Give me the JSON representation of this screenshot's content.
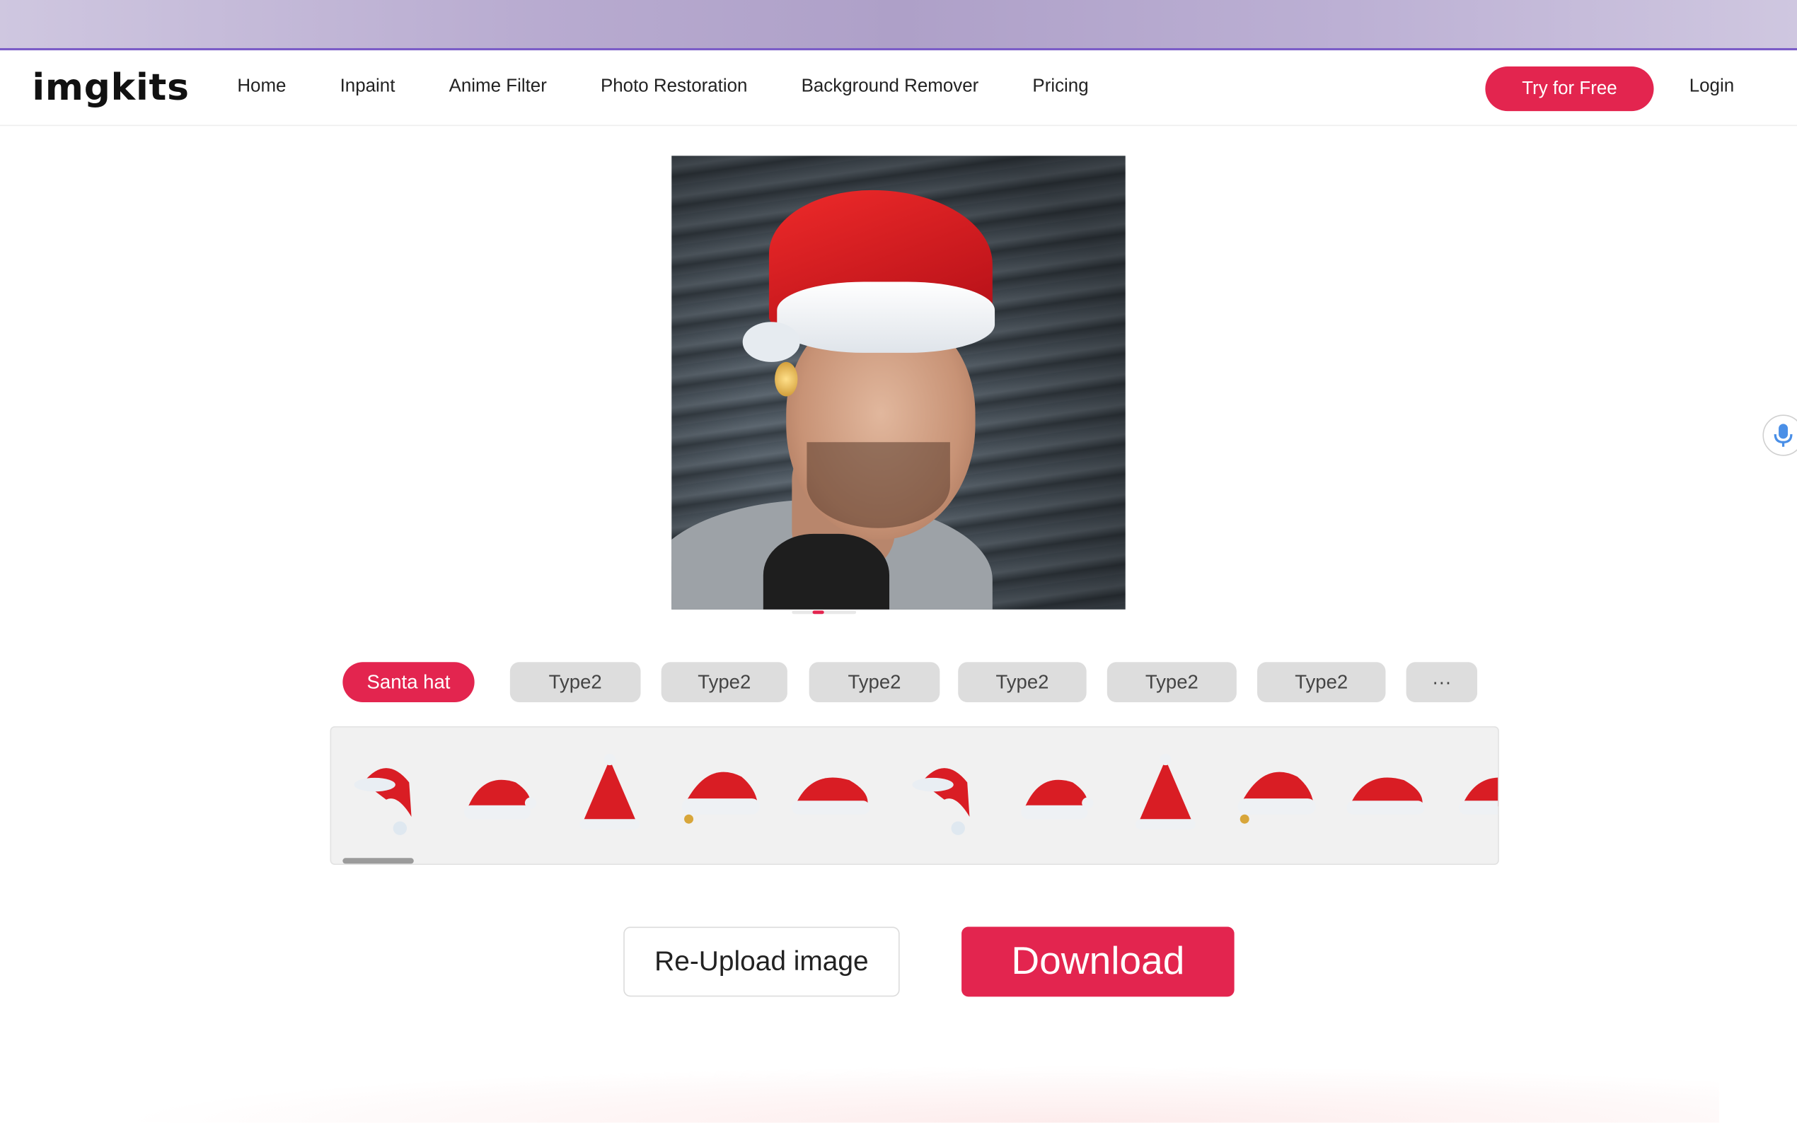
{
  "brand": {
    "logo": "imgkits"
  },
  "nav": {
    "items": [
      "Home",
      "Inpaint",
      "Anime Filter",
      "Photo Restoration",
      "Background Remover",
      "Pricing"
    ],
    "cta": "Try for Free",
    "login": "Login"
  },
  "tabs": [
    "Santa hat",
    "Type2",
    "Type2",
    "Type2",
    "Type2",
    "Type2",
    "Type2",
    "···"
  ],
  "hats": [
    "santa-hat-icon",
    "santa-hat-icon",
    "santa-hat-icon",
    "santa-hat-icon",
    "santa-hat-icon",
    "santa-hat-icon",
    "santa-hat-icon",
    "santa-hat-icon",
    "santa-hat-icon",
    "santa-hat-icon",
    "santa-hat-icon"
  ],
  "actions": {
    "reupload": "Re-Upload image",
    "download": "Download"
  },
  "colors": {
    "accent": "#e3254f",
    "header_line": "#7a5bc7"
  }
}
